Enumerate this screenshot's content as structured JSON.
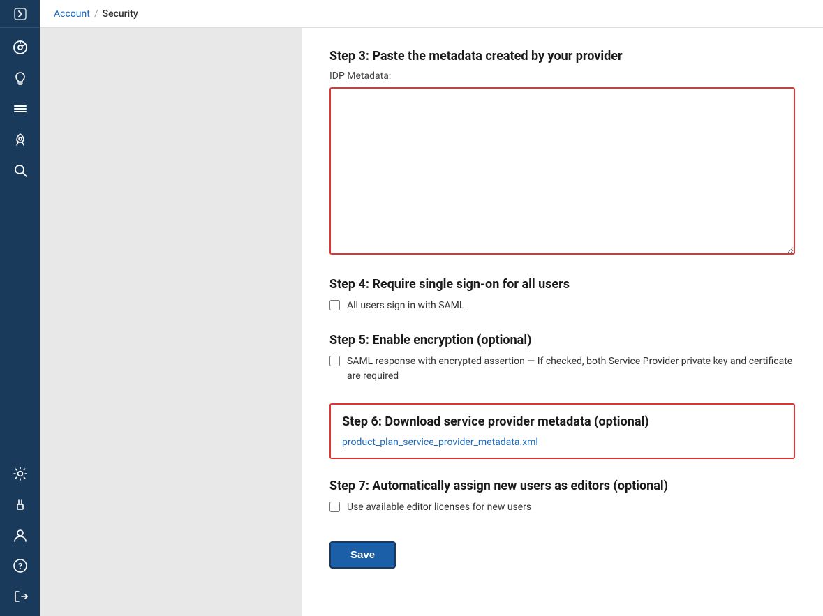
{
  "breadcrumb": {
    "account_label": "Account",
    "separator": "/",
    "current_label": "Security"
  },
  "sidebar": {
    "toggle_icon": "chevron-right",
    "top_icons": [
      {
        "name": "dashboard-icon",
        "symbol": "⊙"
      },
      {
        "name": "lightbulb-icon",
        "symbol": "💡"
      },
      {
        "name": "menu-icon",
        "symbol": "≡"
      },
      {
        "name": "rocket-icon",
        "symbol": "🚀"
      },
      {
        "name": "search-icon",
        "symbol": "🔍"
      }
    ],
    "bottom_icons": [
      {
        "name": "settings-icon",
        "symbol": "⚙"
      },
      {
        "name": "plugin-icon",
        "symbol": "🔌"
      },
      {
        "name": "user-icon",
        "symbol": "👤"
      },
      {
        "name": "help-icon",
        "symbol": "?"
      },
      {
        "name": "logout-icon",
        "symbol": "↪"
      }
    ]
  },
  "steps": {
    "step3": {
      "title": "Step 3: Paste the metadata created by your provider",
      "field_label": "IDP Metadata:",
      "textarea_value": "",
      "textarea_placeholder": ""
    },
    "step4": {
      "title": "Step 4: Require single sign-on for all users",
      "checkbox_label": "All users sign in with SAML",
      "checked": false
    },
    "step5": {
      "title": "Step 5: Enable encryption (optional)",
      "checkbox_label": "SAML response with encrypted assertion — If checked, both Service Provider private key and certificate are required",
      "checked": false
    },
    "step6": {
      "title": "Step 6: Download service provider metadata (optional)",
      "link_text": "product_plan_service_provider_metadata.xml",
      "link_href": "#"
    },
    "step7": {
      "title": "Step 7: Automatically assign new users as editors (optional)",
      "checkbox_label": "Use available editor licenses for new users",
      "checked": false
    }
  },
  "save_button_label": "Save"
}
